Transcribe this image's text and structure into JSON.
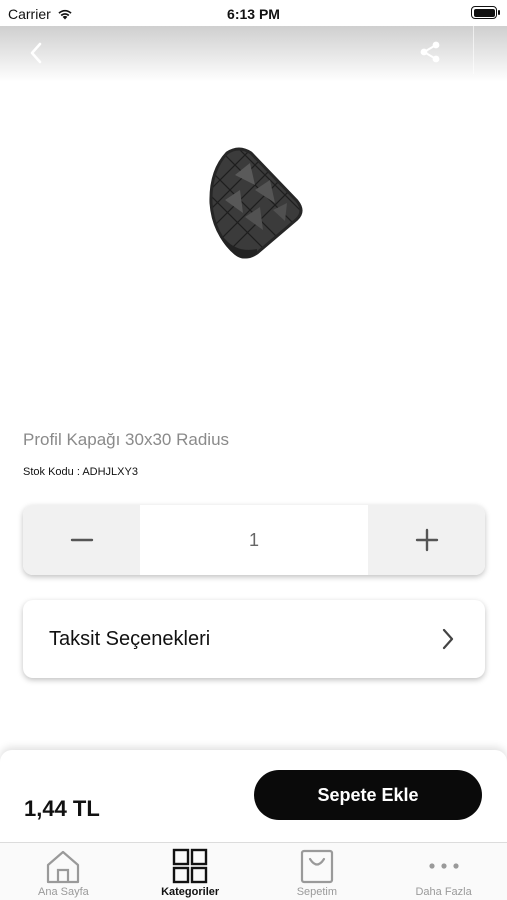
{
  "status_bar": {
    "carrier": "Carrier",
    "time": "6:13 PM"
  },
  "nav": {
    "back_icon": "chevron-left-icon",
    "share_icon": "share-icon"
  },
  "product": {
    "title": "Profil Kapağı 30x30 Radius",
    "stock_code": "Stok Kodu : ADHJLXY3",
    "quantity": "1"
  },
  "installment": {
    "label": "Taksit Seçenekleri"
  },
  "purchase": {
    "price": "1,44 TL",
    "add_to_cart_label": "Sepete Ekle"
  },
  "tabs": [
    {
      "label": "Ana Sayfa",
      "icon": "home-icon",
      "active": false
    },
    {
      "label": "Kategoriler",
      "icon": "grid-icon",
      "active": true
    },
    {
      "label": "Sepetim",
      "icon": "shopping-bag-icon",
      "active": false
    },
    {
      "label": "Daha Fazla",
      "icon": "more-icon",
      "active": false
    }
  ],
  "colors": {
    "accent": "#0a0a0a",
    "inactive_tab": "#9a9a9a"
  }
}
